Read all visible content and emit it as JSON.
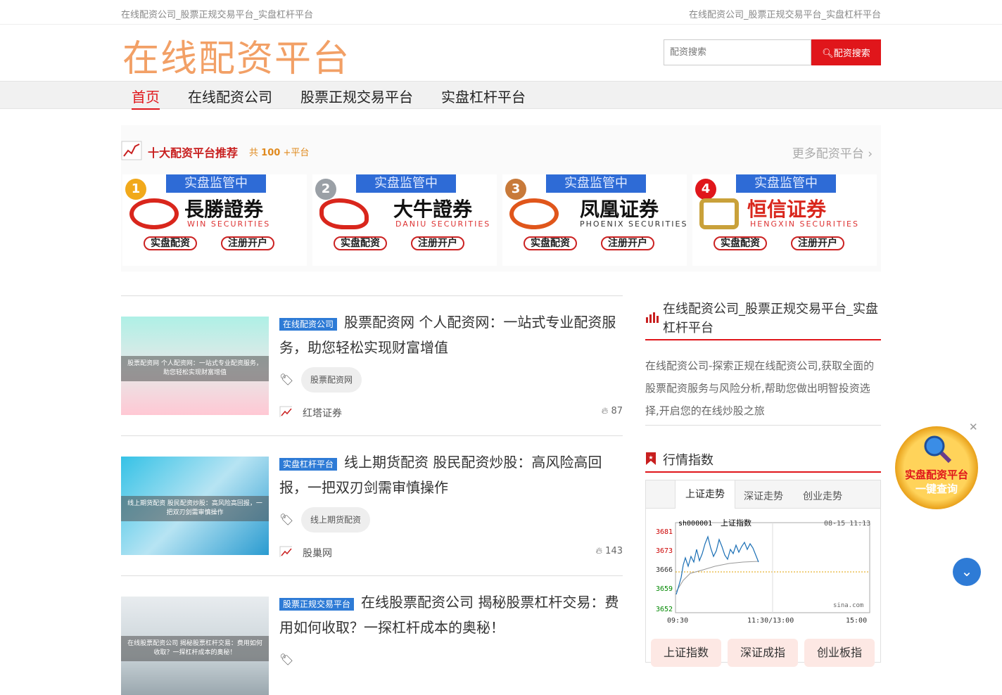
{
  "topbar": {
    "left": "在线配资公司_股票正规交易平台_实盘杠杆平台",
    "right": "在线配资公司_股票正规交易平台_实盘杠杆平台"
  },
  "logo": "在线配资平台",
  "search": {
    "placeholder": "配资搜索",
    "button": "配资搜索"
  },
  "nav": [
    "首页",
    "在线配资公司",
    "股票正规交易平台",
    "实盘杠杆平台"
  ],
  "recommend": {
    "title": "十大配资平台推荐",
    "count_prefix": "共",
    "count": "100",
    "count_suffix": "+平台",
    "more": "更多配资平台",
    "badge": "实盘监管中",
    "btn1": "实盘配资",
    "btn2": "注册开户",
    "cards": [
      {
        "rank": "1",
        "name": "長勝證券",
        "sub": "WIN SECURITIES"
      },
      {
        "rank": "2",
        "name": "大牛證券",
        "sub": "DANIU SECURITIES"
      },
      {
        "rank": "3",
        "name": "凤凰证券",
        "sub": "PHOENIX SECURITIES"
      },
      {
        "rank": "4",
        "name": "恒信证券",
        "sub": "HENGXIN SECURITIES"
      }
    ]
  },
  "posts": [
    {
      "category": "在线配资公司",
      "title": "股票配资网 个人配资网：一站式专业配资服务，助您轻松实现财富增值",
      "caption": "股票配资网 个人配资网：一站式专业配资服务，助您轻松实现财富增值",
      "tag": "股票配资网",
      "author": "红塔证券",
      "views": "87"
    },
    {
      "category": "实盘杠杆平台",
      "title": "线上期货配资 股民配资炒股：高风险高回报，一把双刃剑需审慎操作",
      "caption": "线上期货配资 股民配资炒股：高风险高回报，一把双刃剑需审慎操作",
      "tag": "线上期货配资",
      "author": "股巢网",
      "views": "143"
    },
    {
      "category": "股票正规交易平台",
      "title": "在线股票配资公司 揭秘股票杠杆交易：费用如何收取？一探杠杆成本的奥秘！",
      "caption": "在线股票配资公司 揭秘股票杠杆交易：费用如何收取？一探杠杆成本的奥秘！",
      "tag": "",
      "author": "",
      "views": ""
    }
  ],
  "sidebar": {
    "site_title": "在线配资公司_股票正规交易平台_实盘杠杆平台",
    "description": "在线配资公司-探索正规在线配资公司,获取全面的股票配资服务与风险分析,帮助您做出明智投资选择,开启您的在线炒股之旅",
    "market_title": "行情指数",
    "tabs": [
      "上证走势",
      "深证走势",
      "创业走势"
    ],
    "chart": {
      "code": "sh000001",
      "name": "上证指数",
      "datetime": "08-15 11:13",
      "source": "sina.com",
      "y_ticks": [
        "3681",
        "3673",
        "3666",
        "3659",
        "3652"
      ],
      "x_ticks": [
        "09:30",
        "11:30/13:00",
        "15:00"
      ]
    },
    "index_buttons": [
      "上证指数",
      "深证成指",
      "创业板指"
    ]
  },
  "float_badge": {
    "line1": "实盘配资平台",
    "line2": "一键查询"
  },
  "colors": {
    "accent": "#e0161b",
    "blue": "#2e7bd6"
  }
}
